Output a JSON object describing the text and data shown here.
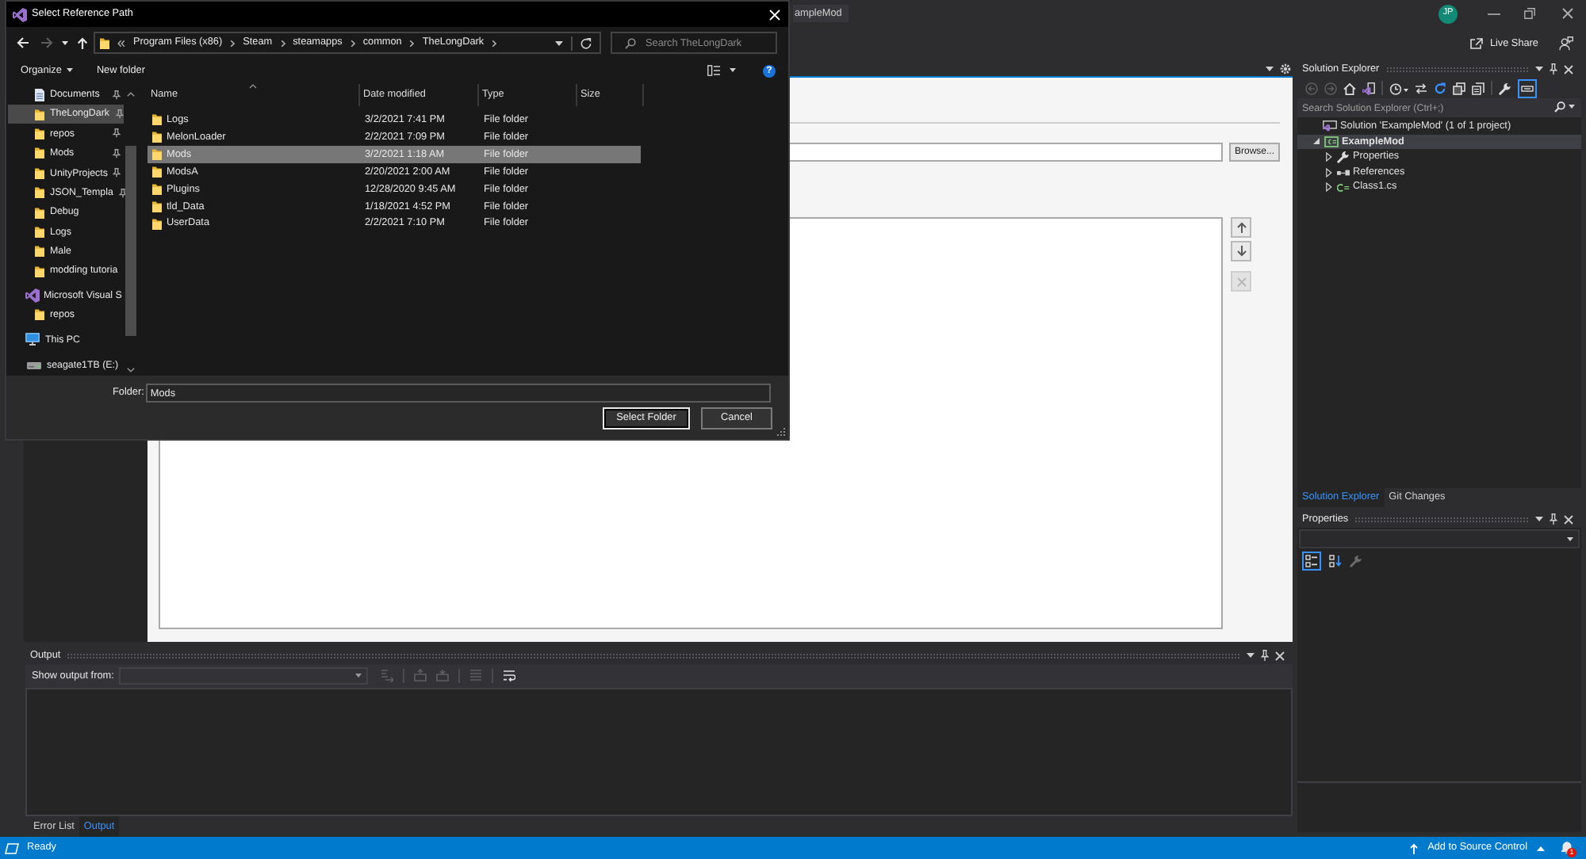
{
  "dialog": {
    "title": "Select Reference Path",
    "nav_buttons": [
      {
        "kind": "back",
        "disabled": false
      },
      {
        "kind": "forward",
        "disabled": true
      },
      {
        "kind": "recent",
        "disabled": false
      },
      {
        "kind": "up",
        "disabled": false
      }
    ],
    "breadcrumb": [
      "Program Files (x86)",
      "Steam",
      "steamapps",
      "common",
      "TheLongDark"
    ],
    "search": {
      "placeholder": "Search TheLongDark"
    },
    "commands": [
      {
        "label": "Organize",
        "kind": "menu"
      },
      {
        "label": "New folder",
        "kind": "button"
      }
    ],
    "help": "?",
    "nav": [
      {
        "label": "Documents",
        "kind": "documents",
        "pinned": true,
        "selected": false
      },
      {
        "label": "TheLongDark",
        "kind": "folder",
        "pinned": true,
        "selected": true
      },
      {
        "label": "repos",
        "kind": "folder",
        "pinned": true,
        "selected": false
      },
      {
        "label": "Mods",
        "kind": "folder",
        "pinned": true,
        "selected": false
      },
      {
        "label": "UnityProjects",
        "kind": "folder",
        "pinned": true,
        "selected": false
      },
      {
        "label": "JSON_Templa",
        "kind": "folder",
        "pinned": true,
        "selected": false
      },
      {
        "label": "Debug",
        "kind": "folder",
        "pinned": false,
        "selected": false
      },
      {
        "label": "Logs",
        "kind": "folder",
        "pinned": false,
        "selected": false
      },
      {
        "label": "Male",
        "kind": "folder",
        "pinned": false,
        "selected": false
      },
      {
        "label": "modding tutoria",
        "kind": "folder",
        "pinned": false,
        "selected": false
      },
      {
        "label": "Microsoft Visual S",
        "kind": "app",
        "pinned": false,
        "selected": false,
        "children": [
          {
            "label": "repos",
            "kind": "folder",
            "pinned": false,
            "selected": false
          }
        ]
      },
      {
        "label": "This PC",
        "kind": "pc",
        "pinned": false,
        "selected": false
      },
      {
        "label": "seagate1TB (E:)",
        "kind": "drive",
        "pinned": false,
        "selected": false
      }
    ],
    "columns": [
      {
        "label": "Name",
        "sorted": true
      },
      {
        "label": "Date modified",
        "sorted": false
      },
      {
        "label": "Type",
        "sorted": false
      },
      {
        "label": "Size",
        "sorted": false
      }
    ],
    "rows": [
      {
        "name": "Logs",
        "date_modified": "3/2/2021 7:41 PM",
        "type": "File folder",
        "selected": false
      },
      {
        "name": "MelonLoader",
        "date_modified": "2/2/2021 7:09 PM",
        "type": "File folder",
        "selected": false
      },
      {
        "name": "Mods",
        "date_modified": "3/2/2021 1:18 AM",
        "type": "File folder",
        "selected": true
      },
      {
        "name": "ModsA",
        "date_modified": "2/20/2021 2:00 AM",
        "type": "File folder",
        "selected": false
      },
      {
        "name": "Plugins",
        "date_modified": "12/28/2020 9:45 AM",
        "type": "File folder",
        "selected": false
      },
      {
        "name": "tld_Data",
        "date_modified": "1/18/2021 4:52 PM",
        "type": "File folder",
        "selected": false
      },
      {
        "name": "UserData",
        "date_modified": "2/2/2021 7:10 PM",
        "type": "File folder",
        "selected": false
      }
    ],
    "folder_field": {
      "label": "Folder:",
      "value": "Mods"
    },
    "buttons": [
      {
        "label": "Select Folder",
        "default": true
      },
      {
        "label": "Cancel",
        "default": false
      }
    ]
  },
  "ide": {
    "project_tab": "ampleMod",
    "avatar": "JP",
    "live_share": "Live Share"
  },
  "reference_page": {
    "browse_button": "Browse...",
    "path_buttons": [
      {
        "kind": "up",
        "disabled": false
      },
      {
        "kind": "down",
        "disabled": false
      },
      {
        "kind": "remove",
        "disabled": true
      }
    ]
  },
  "solution_explorer": {
    "title": "Solution Explorer",
    "toolbar": [
      {
        "kind": "back",
        "disabled": true,
        "on": false
      },
      {
        "kind": "forward",
        "disabled": true,
        "on": false
      },
      {
        "kind": "home",
        "disabled": false,
        "on": false
      },
      {
        "kind": "switch-views",
        "disabled": false,
        "on": false
      },
      {
        "kind": "pending-changes",
        "disabled": false,
        "on": false
      },
      {
        "kind": "sync",
        "disabled": false,
        "on": false
      },
      {
        "kind": "refresh",
        "disabled": false,
        "on": false
      },
      {
        "kind": "collapse",
        "disabled": false,
        "on": false
      },
      {
        "kind": "show-all",
        "disabled": false,
        "on": false
      },
      {
        "kind": "properties",
        "disabled": false,
        "on": false
      },
      {
        "kind": "preview",
        "disabled": false,
        "on": true
      }
    ],
    "search": {
      "placeholder": "Search Solution Explorer (Ctrl+;)"
    },
    "tree": [
      {
        "label": "Solution 'ExampleMod' (1 of 1 project)",
        "kind": "solution",
        "selected": false,
        "children": [
          {
            "label": "ExampleMod",
            "kind": "project",
            "selected": true,
            "expanded": true,
            "children": [
              {
                "label": "Properties",
                "kind": "properties",
                "selected": false,
                "expanded": false
              },
              {
                "label": "References",
                "kind": "references",
                "selected": false,
                "expanded": false
              },
              {
                "label": "Class1.cs",
                "kind": "csharp",
                "selected": false,
                "expanded": false
              }
            ]
          }
        ]
      }
    ],
    "tabs": [
      {
        "label": "Solution Explorer",
        "selected": true
      },
      {
        "label": "Git Changes",
        "selected": false
      }
    ]
  },
  "properties": {
    "title": "Properties",
    "toolbar": [
      {
        "kind": "categorized",
        "selected": true,
        "disabled": false
      },
      {
        "kind": "alphabetical",
        "selected": false,
        "disabled": false
      },
      {
        "kind": "property-pages",
        "selected": false,
        "disabled": true
      }
    ]
  },
  "output": {
    "title": "Output",
    "source_label": "Show output from:",
    "toolbar": [
      {
        "kind": "go-to",
        "disabled": true
      },
      {
        "kind": "previous",
        "disabled": true
      },
      {
        "kind": "next",
        "disabled": true
      },
      {
        "kind": "clear",
        "disabled": true
      },
      {
        "kind": "word-wrap",
        "disabled": false
      }
    ],
    "tabs": [
      {
        "label": "Error List",
        "selected": false
      },
      {
        "label": "Output",
        "selected": true
      }
    ]
  },
  "status_bar": {
    "text": "Ready",
    "source_control": "Add to Source Control",
    "notifications": "1"
  }
}
